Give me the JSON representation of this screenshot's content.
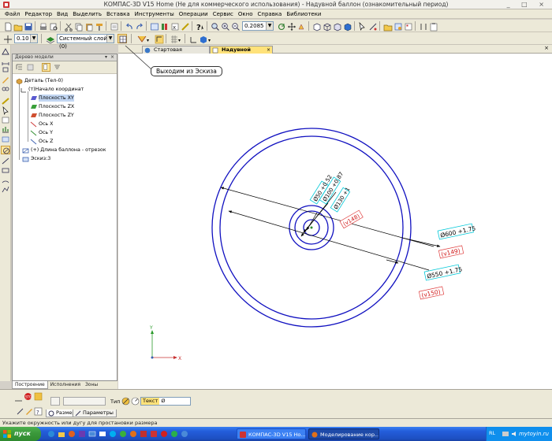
{
  "window": {
    "title": "КОМПАС-3D V15 Home (Не для коммерческого использования) - Надувной баллон (ознакомительный период)",
    "controls": "_ □ ×"
  },
  "menu": [
    "Файл",
    "Редактор",
    "Вид",
    "Выделить",
    "Вставка",
    "Инструменты",
    "Операции",
    "Сервис",
    "Окно",
    "Справка",
    "Библиотеки"
  ],
  "toolbar": {
    "zoom_value": "0.2085",
    "step_value": "0.10",
    "layer_value": "Системный слой (0)"
  },
  "doc_tabs": [
    {
      "label": "Стартовая страница",
      "active": false
    },
    {
      "label": "Надувной баллон",
      "active": true
    }
  ],
  "callout": {
    "text": "Выходим из Эскиза"
  },
  "tree_panel": {
    "title": "Дерево модели",
    "pin": "▾",
    "close": "×",
    "nodes": [
      {
        "label": "Деталь (Тел-0)",
        "icon": "part-icon"
      },
      {
        "label": "(т)Начало координат",
        "icon": "origin-icon"
      },
      {
        "label": "Плоскость XY",
        "icon": "plane-xy-icon"
      },
      {
        "label": "Плоскость ZX",
        "icon": "plane-zx-icon"
      },
      {
        "label": "Плоскость ZY",
        "icon": "plane-zy-icon"
      },
      {
        "label": "Ось X",
        "icon": "axis-x-icon"
      },
      {
        "label": "Ось Y",
        "icon": "axis-y-icon"
      },
      {
        "label": "Ось Z",
        "icon": "axis-z-icon"
      },
      {
        "label": "(+) Длина баллона - отрезок",
        "icon": "segment-icon"
      },
      {
        "label": "Эскиз:3",
        "icon": "sketch-icon"
      }
    ],
    "bottom_tabs": [
      "Построение",
      "Исполнения",
      "Зоны"
    ]
  },
  "drawing": {
    "dimensions": [
      {
        "label": "Ø50 +0.52",
        "note": ""
      },
      {
        "label": "Ø100 +0.87",
        "note": ""
      },
      {
        "label": "Ø130 +1",
        "note": "(v148)"
      },
      {
        "label": "Ø600 +1.75",
        "note": "(v149)"
      },
      {
        "label": "Ø550 +1.75",
        "note": "(v150)"
      }
    ],
    "axis_labels": {
      "x": "X",
      "y": "Y"
    }
  },
  "props_panel": {
    "type_label": "Тип",
    "text_label": "Текст",
    "text_value": "Ø",
    "tabs": [
      "Размер",
      "Параметры"
    ]
  },
  "status": {
    "text": "Укажите окружность или дугу для простановки размера"
  },
  "taskbar": {
    "start": "пуск",
    "tasks": [
      {
        "label": "КОМПАС-3D V15 Ho...",
        "active": false
      },
      {
        "label": "Моделирование кор...",
        "active": true
      }
    ],
    "tray_lang": "RL",
    "watermark": "mytoyin.ru"
  },
  "colors": {
    "circle_blue": "#1010c0",
    "dimension_black": "#000000",
    "label_cyan": "#00c8d8",
    "note_red": "#d01818",
    "selected_yellow": "#ffe27a"
  }
}
